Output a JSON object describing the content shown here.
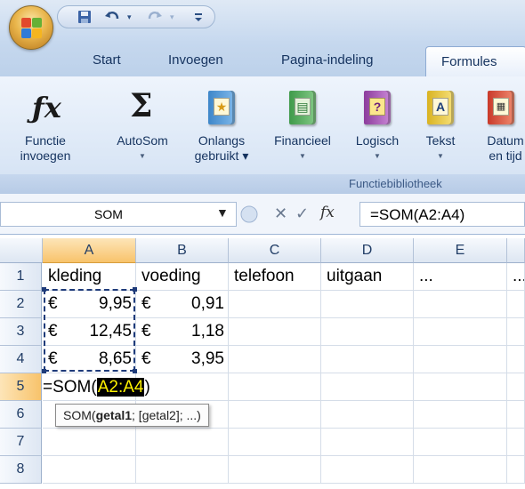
{
  "quick_access": {
    "items": [
      "save-icon",
      "undo-icon",
      "redo-icon",
      "customize-icon"
    ]
  },
  "tabs": [
    "Start",
    "Invoegen",
    "Pagina-indeling",
    "Formules"
  ],
  "active_tab": "Formules",
  "ribbon": {
    "buttons": [
      {
        "label": "Functie\ninvoegen",
        "icon": "fx-icon",
        "dropdown": false
      },
      {
        "label": "AutoSom",
        "icon": "sigma-icon",
        "dropdown": true
      },
      {
        "label": "Onlangs\ngebruikt",
        "icon": "recent-book-icon",
        "dropdown": true
      },
      {
        "label": "Financieel",
        "icon": "financial-book-icon",
        "dropdown": true
      },
      {
        "label": "Logisch",
        "icon": "logical-book-icon",
        "dropdown": true
      },
      {
        "label": "Tekst",
        "icon": "text-book-icon",
        "dropdown": true
      },
      {
        "label": "Datum\nen tijd",
        "icon": "date-book-icon",
        "dropdown": false
      }
    ],
    "group_label": "Functiebibliotheek"
  },
  "formula_bar": {
    "name_box": "SOM",
    "fx_label": "fx",
    "formula": "=SOM(A2:A4)"
  },
  "sheet": {
    "columns": [
      "A",
      "B",
      "C",
      "D",
      "E",
      ""
    ],
    "rows": [
      "1",
      "2",
      "3",
      "4",
      "5",
      "6",
      "7",
      "8"
    ],
    "cells": {
      "A1": "kleding",
      "B1": "voeding",
      "C1": "telefoon",
      "D1": "uitgaan",
      "E1": "...",
      "F1": "...",
      "A2_cur": "€",
      "A2_amt": "9,95",
      "B2_cur": "€",
      "B2_amt": "0,91",
      "A3_cur": "€",
      "A3_amt": "12,45",
      "B3_cur": "€",
      "B3_amt": "1,18",
      "A4_cur": "€",
      "A4_amt": "8,65",
      "B4_cur": "€",
      "B4_amt": "3,95"
    },
    "editing": {
      "prefix": "=SOM(",
      "range": "A2:A4",
      "suffix": ")"
    },
    "tooltip": {
      "func": "SOM(",
      "arg1": "getal1",
      "rest": "; [getal2]; ...)"
    }
  },
  "colors": {
    "selected_header": "#f8c36b",
    "ribbon_bg": "#dbe7f6",
    "edit_highlight": "#fff200"
  }
}
